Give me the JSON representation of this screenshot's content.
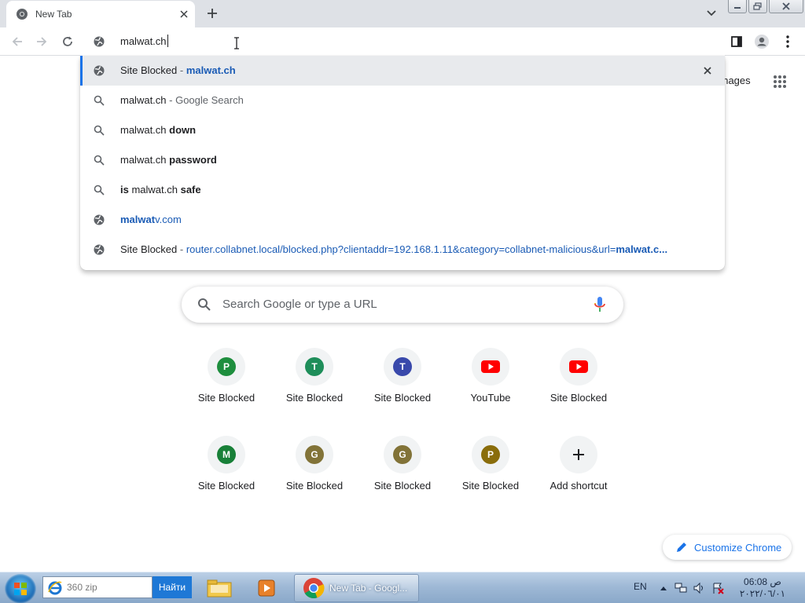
{
  "browser": {
    "tab": {
      "title": "New Tab"
    },
    "omnibox": {
      "value": "malwat.ch"
    }
  },
  "suggestions": [
    {
      "icon": "globe-icon",
      "selected": true,
      "parts": [
        {
          "t": "Site Blocked",
          "c": ""
        },
        {
          "t": " - ",
          "c": "dim"
        },
        {
          "t": "malwat.ch",
          "c": "url b"
        }
      ]
    },
    {
      "icon": "search-icon",
      "parts": [
        {
          "t": "malwat.ch",
          "c": ""
        },
        {
          "t": " - Google Search",
          "c": "dim"
        }
      ]
    },
    {
      "icon": "search-icon",
      "parts": [
        {
          "t": "malwat.ch ",
          "c": ""
        },
        {
          "t": "down",
          "c": "b"
        }
      ]
    },
    {
      "icon": "search-icon",
      "parts": [
        {
          "t": "malwat.ch ",
          "c": ""
        },
        {
          "t": "password",
          "c": "b"
        }
      ]
    },
    {
      "icon": "search-icon",
      "parts": [
        {
          "t": "is",
          "c": "b"
        },
        {
          "t": " malwat.ch ",
          "c": ""
        },
        {
          "t": "safe",
          "c": "b"
        }
      ]
    },
    {
      "icon": "globe-icon",
      "parts": [
        {
          "t": "malwat",
          "c": "url b"
        },
        {
          "t": "v.com",
          "c": "url"
        }
      ]
    },
    {
      "icon": "globe-icon",
      "parts": [
        {
          "t": "Site Blocked",
          "c": ""
        },
        {
          "t": " - ",
          "c": "dim"
        },
        {
          "t": "router.collabnet.local/blocked.php?clientaddr=192.168.1.11&category=collabnet-malicious&url=",
          "c": "url"
        },
        {
          "t": "malwat.c...",
          "c": "url b"
        }
      ]
    }
  ],
  "ntp": {
    "images_link": "Images",
    "search_placeholder": "Search Google or type a URL",
    "shortcuts_row1": [
      {
        "label": "Site Blocked",
        "letter": "P",
        "color": "#1e8e3e",
        "kind": "letter"
      },
      {
        "label": "Site Blocked",
        "letter": "T",
        "color": "#1e8e5a",
        "kind": "letter"
      },
      {
        "label": "Site Blocked",
        "letter": "T",
        "color": "#3949ab",
        "kind": "letter"
      },
      {
        "label": "YouTube",
        "letter": "",
        "color": "#ff0000",
        "kind": "youtube"
      },
      {
        "label": "Site Blocked",
        "letter": "",
        "color": "#ff0000",
        "kind": "youtube"
      }
    ],
    "shortcuts_row2": [
      {
        "label": "Site Blocked",
        "letter": "M",
        "color": "#188038",
        "kind": "letter"
      },
      {
        "label": "Site Blocked",
        "letter": "G",
        "color": "#827338",
        "kind": "letter"
      },
      {
        "label": "Site Blocked",
        "letter": "G",
        "color": "#827338",
        "kind": "letter"
      },
      {
        "label": "Site Blocked",
        "letter": "P",
        "color": "#8a6d0b",
        "kind": "letter"
      },
      {
        "label": "Add shortcut",
        "letter": "+",
        "color": "#202124",
        "kind": "add"
      }
    ],
    "customize_label": "Customize Chrome"
  },
  "taskbar": {
    "search_text": "360 zip",
    "search_button": "Найти",
    "chrome_task": "New Tab - Googl...",
    "lang": "EN",
    "time": "06:08 ص",
    "date": "٢٠٢٢/٠٦/٠١"
  }
}
